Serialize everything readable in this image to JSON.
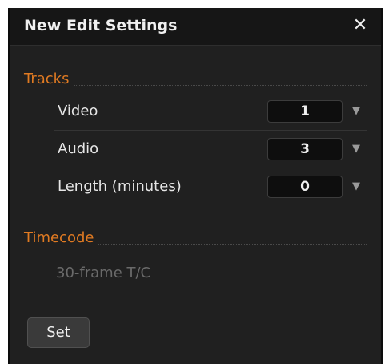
{
  "dialog": {
    "title": "New Edit Settings",
    "close_icon": "✕"
  },
  "tracks": {
    "heading": "Tracks",
    "rows": [
      {
        "label": "Video",
        "value": "1"
      },
      {
        "label": "Audio",
        "value": "3"
      },
      {
        "label": "Length (minutes)",
        "value": "0"
      }
    ],
    "dropdown_icon": "▼"
  },
  "timecode": {
    "heading": "Timecode",
    "value": "30-frame T/C"
  },
  "actions": {
    "set_label": "Set"
  },
  "colors": {
    "accent": "#e07a22",
    "background": "#202020",
    "titlebar": "#161616"
  }
}
